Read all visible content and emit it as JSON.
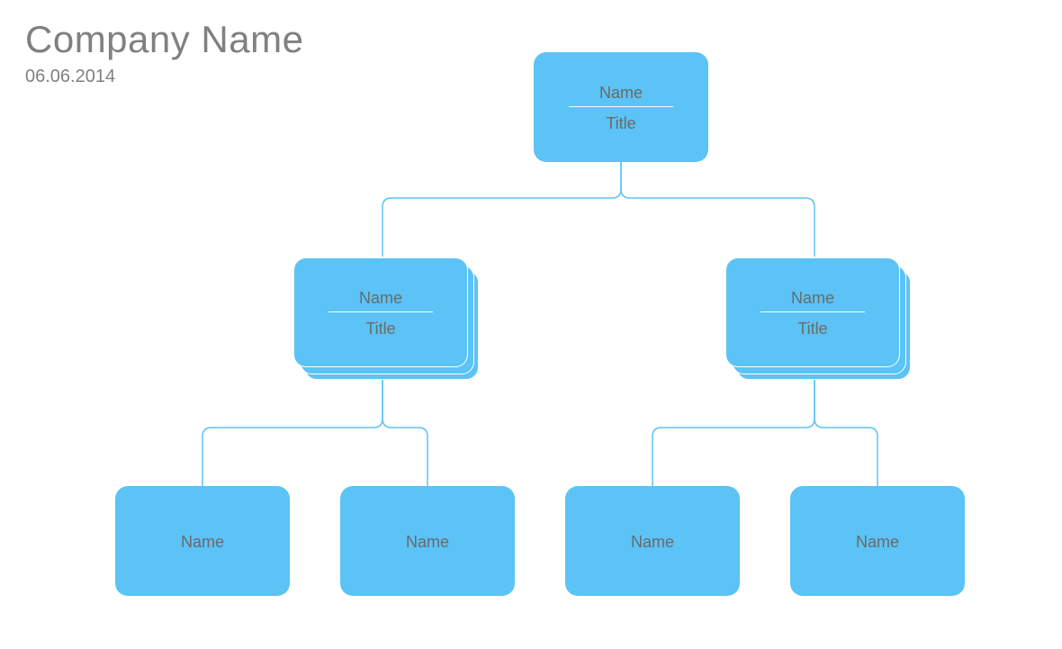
{
  "header": {
    "company": "Company Name",
    "date": "06.06.2014"
  },
  "colors": {
    "node": "#5bc3f5",
    "text": "#6a6a6a",
    "title": "#808080"
  },
  "org": {
    "root": {
      "name": "Name",
      "title": "Title"
    },
    "level2": [
      {
        "name": "Name",
        "title": "Title",
        "stacked": true
      },
      {
        "name": "Name",
        "title": "Title",
        "stacked": true
      }
    ],
    "level3": [
      {
        "name": "Name"
      },
      {
        "name": "Name"
      },
      {
        "name": "Name"
      },
      {
        "name": "Name"
      }
    ]
  }
}
